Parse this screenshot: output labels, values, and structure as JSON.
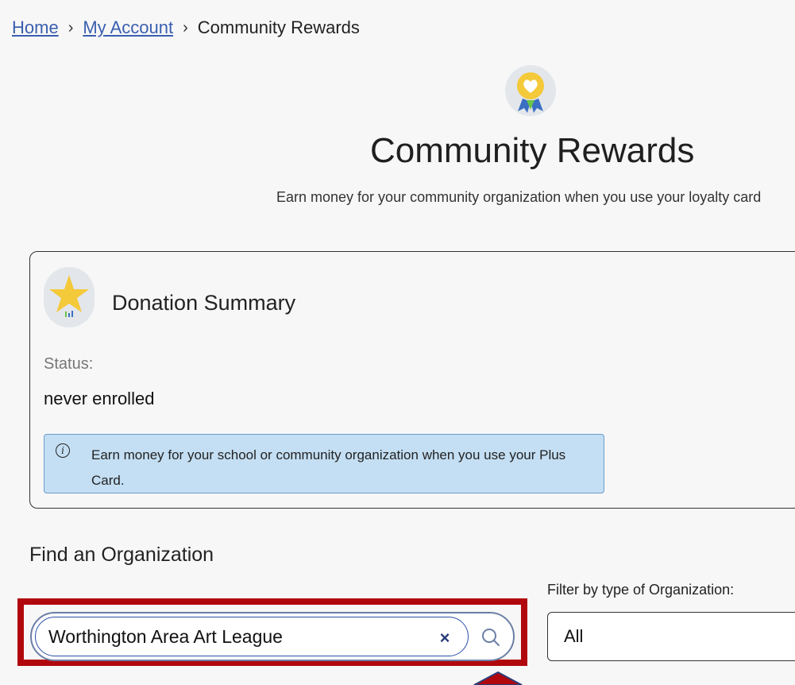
{
  "breadcrumb": {
    "home": "Home",
    "account": "My Account",
    "current": "Community Rewards",
    "separator": "›"
  },
  "header": {
    "title": "Community Rewards",
    "subtitle": "Earn money for your community organization when you use your loyalty card"
  },
  "summary": {
    "title": "Donation Summary",
    "status_label": "Status:",
    "status_value": "never enrolled",
    "info_text": "Earn money for your school or community organization when you use your Plus Card.",
    "info_icon": "i"
  },
  "find": {
    "title": "Find an Organization",
    "search_value": "Worthington Area Art League",
    "clear_symbol": "×",
    "filter_label": "Filter by type of Organization:",
    "filter_selected": "All"
  },
  "icons": {
    "hero": "award-ribbon-icon",
    "summary": "star-icon",
    "info": "info-icon",
    "clear": "close-icon",
    "search": "search-icon"
  },
  "colors": {
    "link": "#3a5fb0",
    "info_bg": "#c4dff3",
    "highlight": "#b1080d",
    "input_border": "#2a4fa8"
  }
}
